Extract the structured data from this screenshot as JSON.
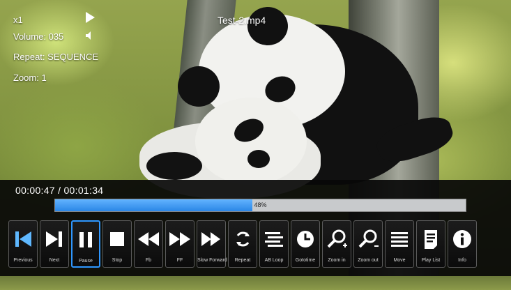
{
  "status": {
    "speed": "x1",
    "volume": "Volume: 035",
    "repeat": "Repeat: SEQUENCE",
    "zoom": "Zoom: 1"
  },
  "file_title": "Test-2.mp4",
  "playback": {
    "time": "00:00:47 / 00:01:34",
    "progress": 0.48,
    "progress_label": "48%"
  },
  "controls": [
    {
      "label": "Previous",
      "icon": "skip-previous-icon"
    },
    {
      "label": "Next",
      "icon": "skip-next-icon"
    },
    {
      "label": "Pause",
      "icon": "pause-icon"
    },
    {
      "label": "Stop",
      "icon": "stop-icon"
    },
    {
      "label": "Fb",
      "icon": "fast-backward-icon"
    },
    {
      "label": "FF",
      "icon": "fast-forward-icon"
    },
    {
      "label": "Slow Forward",
      "icon": "slow-forward-icon"
    },
    {
      "label": "Repeat",
      "icon": "repeat-icon"
    },
    {
      "label": "AB Loop",
      "icon": "ab-loop-icon"
    },
    {
      "label": "Gototime",
      "icon": "clock-icon"
    },
    {
      "label": "Zoom in",
      "icon": "zoom-in-icon"
    },
    {
      "label": "Zoom out",
      "icon": "zoom-out-icon"
    },
    {
      "label": "Move",
      "icon": "move-icon"
    },
    {
      "label": "Play List",
      "icon": "playlist-icon"
    },
    {
      "label": "Info",
      "icon": "info-icon"
    }
  ],
  "colors": {
    "accent": "#2f97ff",
    "progress_fill": "#2a86e6",
    "progress_track": "#c8cacc",
    "panel_bg": "#080808"
  }
}
